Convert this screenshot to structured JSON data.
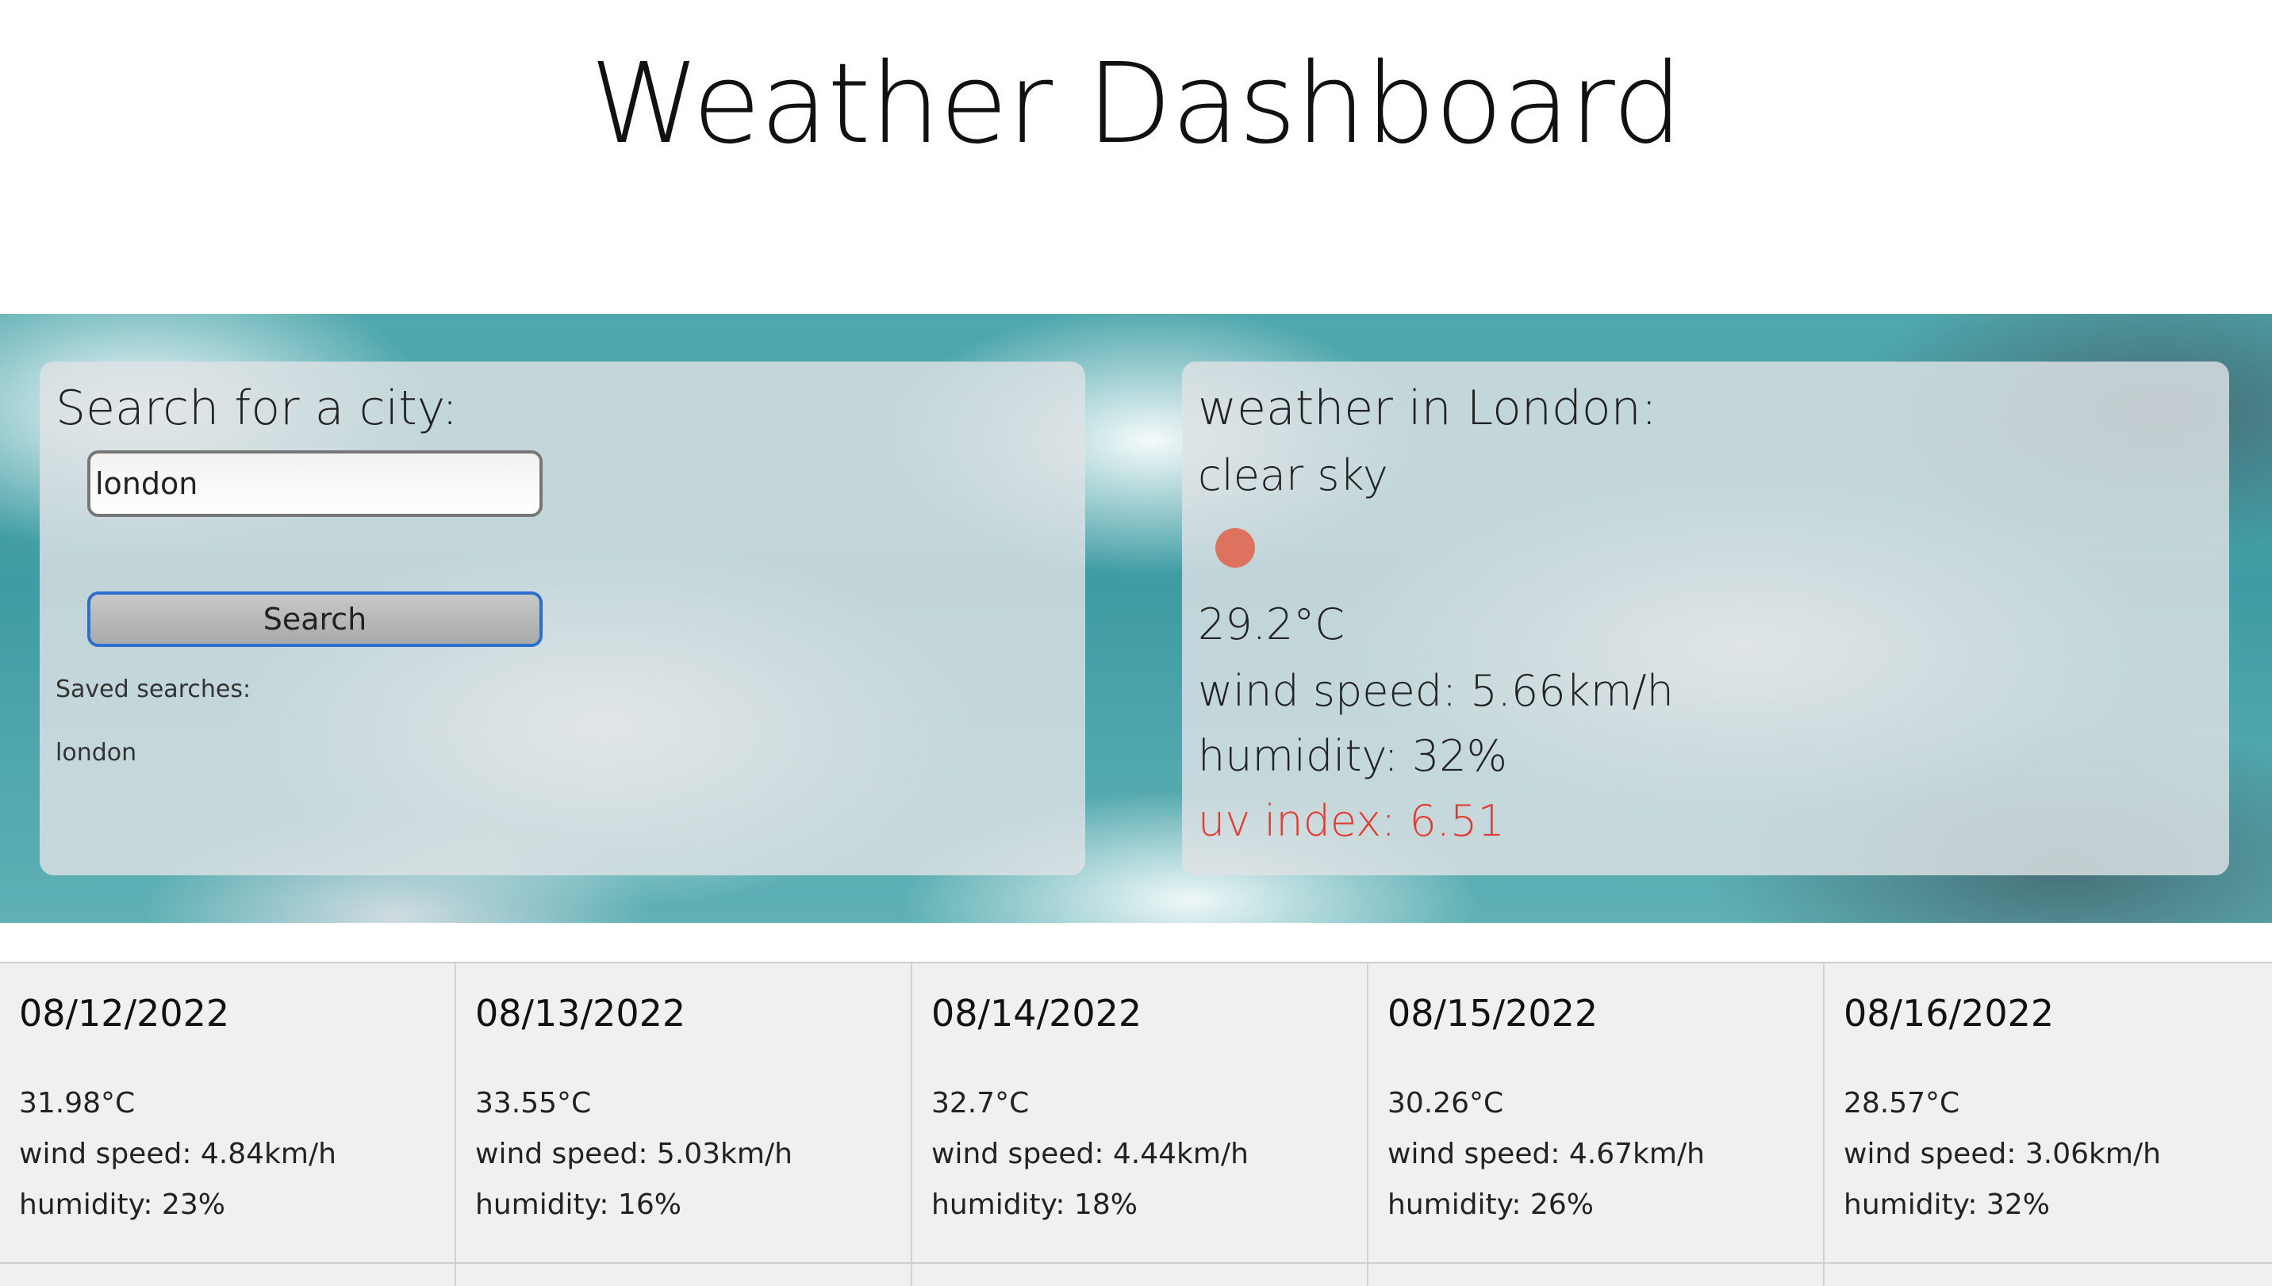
{
  "header": {
    "title": "Weather Dashboard"
  },
  "search": {
    "heading": "Search for a city:",
    "input_value": "london",
    "button_label": "Search",
    "saved_label": "Saved searches:",
    "saved_items": [
      "london"
    ]
  },
  "current": {
    "heading": "weather in London:",
    "description": "clear sky",
    "temperature": "29.2°C",
    "wind": "wind speed: 5.66km/h",
    "humidity": "humidity: 32%",
    "uv": "uv index: 6.51",
    "uv_color": "#e53a2f",
    "icon": "sun-icon"
  },
  "forecast": [
    {
      "date": "08/12/2022",
      "temp": "31.98°C",
      "wind": "wind speed: 4.84km/h",
      "humidity": "humidity: 23%"
    },
    {
      "date": "08/13/2022",
      "temp": "33.55°C",
      "wind": "wind speed: 5.03km/h",
      "humidity": "humidity: 16%"
    },
    {
      "date": "08/14/2022",
      "temp": "32.7°C",
      "wind": "wind speed: 4.44km/h",
      "humidity": "humidity: 18%"
    },
    {
      "date": "08/15/2022",
      "temp": "30.26°C",
      "wind": "wind speed: 4.67km/h",
      "humidity": "humidity: 26%"
    },
    {
      "date": "08/16/2022",
      "temp": "28.57°C",
      "wind": "wind speed: 3.06km/h",
      "humidity": "humidity: 32%"
    }
  ]
}
